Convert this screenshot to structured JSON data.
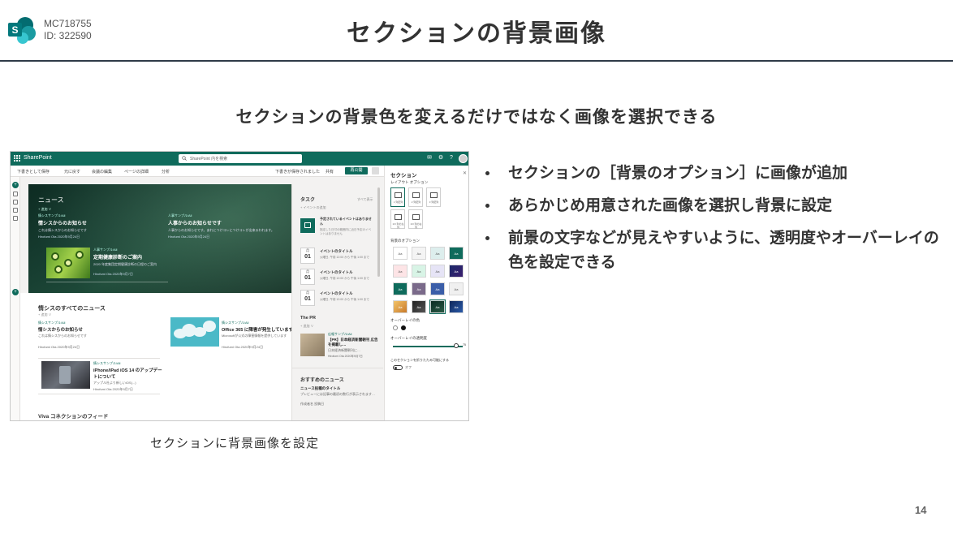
{
  "header": {
    "mc_id": "MC718755",
    "id_label": "ID: 322590",
    "title": "セクションの背景画像",
    "subtitle": "セクションの背景色を変えるだけではなく画像を選択できる",
    "page_number": "14"
  },
  "bullets": [
    "セクションの［背景のオプション］に画像が追加",
    "あらかじめ用意された画像を選択し背景に設定",
    "前景の文字などが見えやすいように、透明度やオーバーレイの色を設定できる"
  ],
  "caption": "セクションに背景画像を設定",
  "colors": {
    "accent": "#0f6b5c",
    "rule": "#2f3b48",
    "hero": "#173e31"
  },
  "screenshot": {
    "topbar": {
      "brand": "SharePoint",
      "search_placeholder": "SharePoint 内を検索"
    },
    "command_bar": {
      "items": [
        "下書きとして保存",
        "元に戻す",
        "会議の編集",
        "ページの詳細",
        "分析"
      ],
      "status": "下書きが保存されました",
      "share": "共有",
      "publish": "再公開"
    },
    "hero": {
      "title": "ニュース",
      "add": "+ 追加 ∨",
      "items": [
        {
          "tag": "情シスサンプル/All",
          "title": "情シスからのお知らせ",
          "desc": "これは情シスからのお知らせです",
          "meta": "Hirofumi Ota 2020年9月24日"
        },
        {
          "tag": "人事サンプル/All",
          "title": "人事からのお知らせです",
          "desc": "人事からのお知らせです。あれにつけコレにつけコレが出来るわれます。",
          "meta": "Hirofumi Ota 2020年9月24日"
        },
        {
          "tag": "人事サンプル/All",
          "title": "定期健康診断のご案内",
          "desc": "2020 年度集団定期健康診断の日程のご案内",
          "meta": "Hirofumi Ota 2020年9月7日"
        }
      ]
    },
    "all_news": {
      "title": "情シスのすべてのニュース",
      "add": "+ 追加 ∨",
      "items": [
        {
          "tag": "情シスサンプル/All",
          "title": "情シスからのお知らせ",
          "desc": "これは情シスからのお知らせです",
          "meta": "Hirofumi Ota 2020年9月24日"
        },
        {
          "tag": "情シスサンプル/All",
          "title": "Office 365 に障害が発生しています",
          "desc": "Microsoftが公式の障害情報を提供しています",
          "meta": "Hirofumi Ota 2020年9月24日"
        },
        {
          "tag": "情シスサンプル/All",
          "title": "iPhone/iPad iOS 14 のアップデートについて",
          "desc": "アップル社より新しいiOS(...)",
          "meta": "Hirofumi Ota 2020年9月7日"
        }
      ],
      "viva": "Viva コネクションのフィード"
    },
    "middle": {
      "tasks_title": "タスク",
      "see_all": "すべて表示",
      "add_event": "+ イベントの追加",
      "no_events": "予定されているイベントはありません",
      "no_events_desc": "指定した日付の範囲内に近日予定のイベントはありません",
      "events": [
        {
          "month": "月",
          "day": "01",
          "title": "イベントのタイトル",
          "time": "火曜日, 午前 12:00 から 午後 1:00 まで"
        },
        {
          "month": "月",
          "day": "01",
          "title": "イベントのタイトル",
          "time": "火曜日, 午前 12:00 から 午後 1:00 まで"
        },
        {
          "month": "月",
          "day": "01",
          "title": "イベントのタイトル",
          "time": "火曜日, 午前 12:00 から 午後 1:00 まで"
        }
      ],
      "pr_title": "The PR",
      "pr_add": "+ 追加 ∨",
      "pr_item": {
        "tag": "広報サンプル/All",
        "title": "【PR】日本経済新聞朝刊 広告を掲載し…",
        "desc": "日本経済新聞朝刊に…",
        "meta": "Hirofumi Ota 2020年9月7日"
      },
      "recommended": "おすすめのニュース",
      "rec_item_title": "ニュース投稿のタイトル",
      "rec_item_desc": "プレビューには記事の最初の数行が表示されます…",
      "rec_meta": "作成者名 投稿日"
    },
    "panel": {
      "title": "セクション",
      "layout_label": "レイアウト オプション",
      "layouts": [
        "1 列配列",
        "2 列配列",
        "3 列配列",
        "1/3 列の左列",
        "1/3 列の右列"
      ],
      "background_label": "背景のオプション",
      "swatch_text": "Aa",
      "overlay_color_label": "オーバーレイの色",
      "overlay_opacity_label": "オーバーレイの透明度",
      "opacity_value": "75",
      "collapse_label": "このセクションを折りたたみ可能にする",
      "toggle_state": "オフ"
    }
  }
}
